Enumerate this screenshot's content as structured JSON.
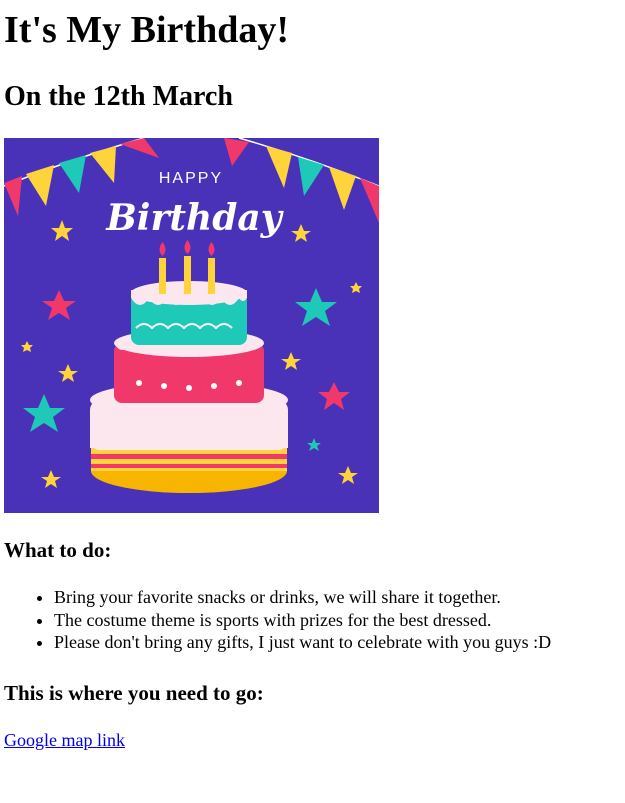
{
  "page": {
    "title": "It's My Birthday!",
    "subtitle": "On the 12th March"
  },
  "poster": {
    "caption_top": "HAPPY",
    "caption_main": "Birthday",
    "colors": {
      "background": "#4a32b8",
      "pink": "#f0386b",
      "teal": "#1ec9b7",
      "yellow": "#ffd43b",
      "cream": "#fde7ee",
      "gold": "#f7b500"
    }
  },
  "todo": {
    "heading": "What to do:",
    "items": [
      "Bring your favorite snacks or drinks, we will share it together.",
      "The costume theme is sports with prizes for the best dressed.",
      "Please don't bring any gifts, I just want to celebrate with you guys :D"
    ]
  },
  "location": {
    "heading": "This is where you need to go:",
    "link_text": "Google map link"
  }
}
